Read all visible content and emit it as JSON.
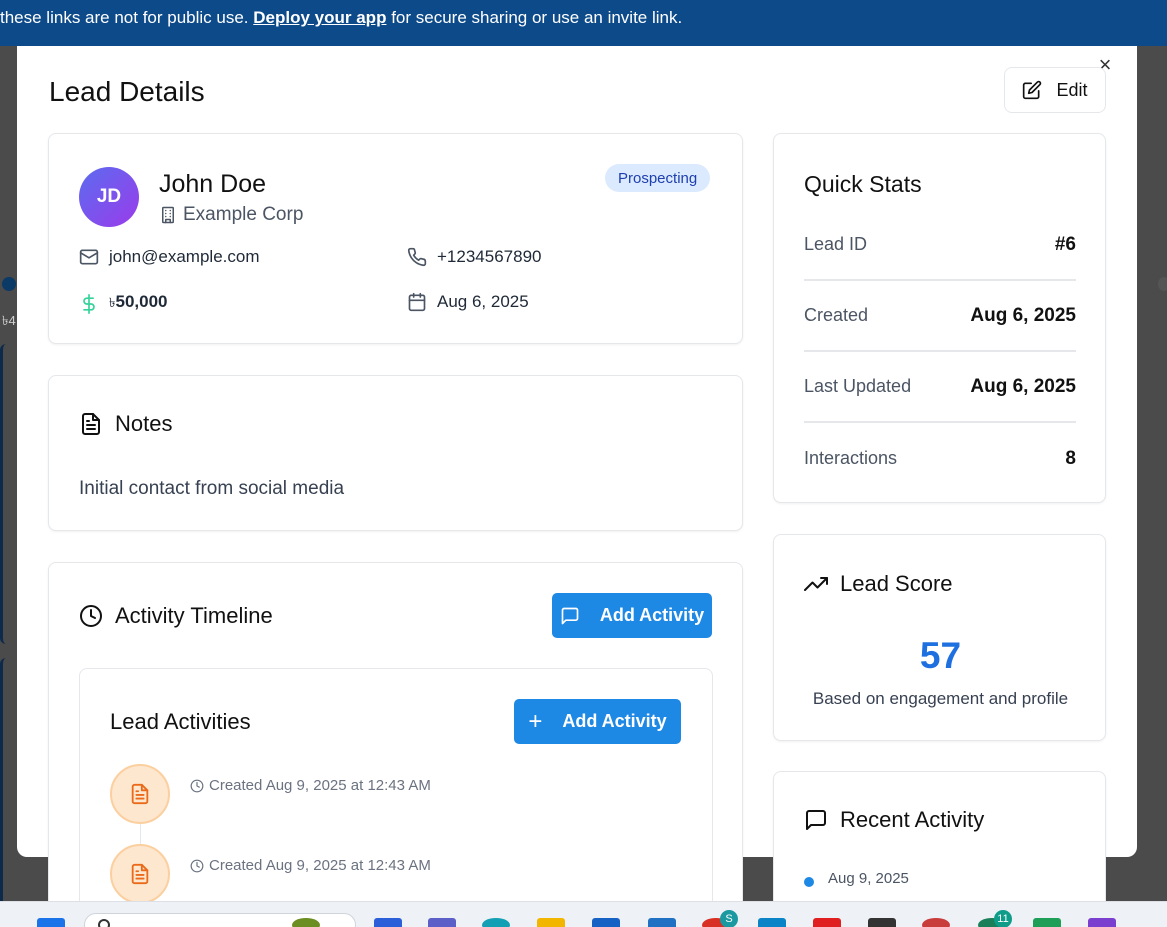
{
  "banner": {
    "text_before": "these links are not for public use.",
    "link": "Deploy your app",
    "text_after": "for secure sharing or use an invite link."
  },
  "backdrop": {
    "partial_amount": "৳4"
  },
  "modal": {
    "title": "Lead Details",
    "edit_label": "Edit",
    "close_label": "×"
  },
  "lead": {
    "initials": "JD",
    "name": "John Doe",
    "company": "Example Corp",
    "status": "Prospecting",
    "email": "john@example.com",
    "phone": "+1234567890",
    "value_currency": "৳",
    "value": "50,000",
    "date": "Aug 6, 2025"
  },
  "notes": {
    "title": "Notes",
    "text": "Initial contact from social media"
  },
  "timeline": {
    "title": "Activity Timeline",
    "add_button": "Add Activity",
    "inner_title": "Lead Activities",
    "inner_add_button": "Add Activity",
    "activities": [
      {
        "meta": "Created Aug 9, 2025 at 12:43 AM"
      },
      {
        "meta": "Created Aug 9, 2025 at 12:43 AM"
      }
    ]
  },
  "stats": {
    "title": "Quick Stats",
    "rows": [
      {
        "label": "Lead ID",
        "value": "#6"
      },
      {
        "label": "Created",
        "value": "Aug 6, 2025"
      },
      {
        "label": "Last Updated",
        "value": "Aug 6, 2025"
      },
      {
        "label": "Interactions",
        "value": "8"
      }
    ]
  },
  "score": {
    "title": "Lead Score",
    "value": "57",
    "subtitle": "Based on engagement and profile",
    "value_color": "#1e6fe0"
  },
  "recent": {
    "title": "Recent Activity",
    "items": [
      {
        "date": "Aug 9, 2025"
      }
    ]
  },
  "taskbar": {
    "search_placeholder": "Search",
    "badges": [
      "S",
      "11"
    ]
  },
  "colors": {
    "primary": "#1e88e5",
    "banner": "#0d4a8a",
    "badge_bg": "#dbeafe",
    "badge_text": "#1e40af",
    "money_icon": "#34d399",
    "activity_icon": "#ea6a1a"
  }
}
